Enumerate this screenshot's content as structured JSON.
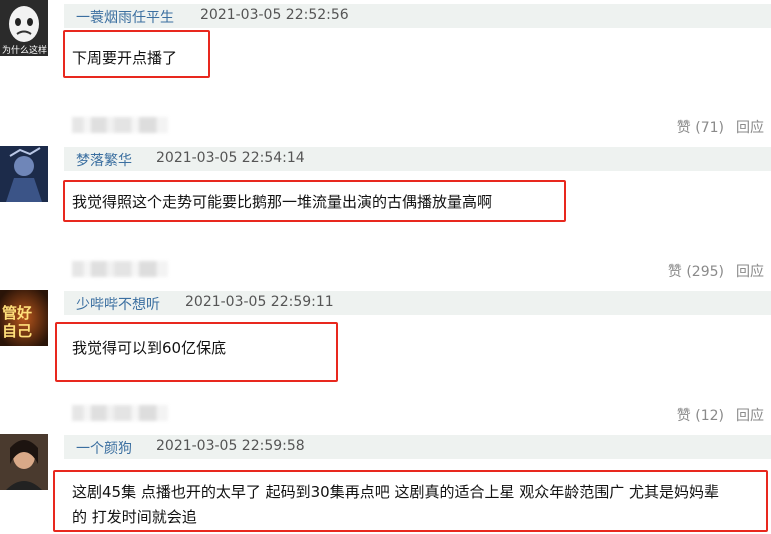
{
  "comments": [
    {
      "user": "一蓑烟雨任平生",
      "time": "2021-03-05 22:52:56",
      "text": "下周要开点播了",
      "avatar_caption": "为什么这样",
      "like_label": "赞 (71)",
      "reply_label": "回应"
    },
    {
      "user": "梦落繁华",
      "time": "2021-03-05 22:54:14",
      "text": "我觉得照这个走势可能要比鹅那一堆流量出演的古偶播放量高啊",
      "like_label": "赞 (295)",
      "reply_label": "回应"
    },
    {
      "user": "少哔哔不想听",
      "time": "2021-03-05 22:59:11",
      "text": "我觉得可以到60亿保底",
      "avatar_caption": "管好 自己",
      "like_label": "赞 (12)",
      "reply_label": "回应"
    },
    {
      "user": "一个颜狗",
      "time": "2021-03-05 22:59:58",
      "text_line1": "这剧45集 点播也开的太早了 起码到30集再点吧 这剧真的适合上星 观众年龄范围广 尤其是妈妈辈",
      "text_line2": "的 打发时间就会追"
    }
  ],
  "colors": {
    "highlight_box": "#e8281e",
    "username": "#3b6fa0",
    "meta_bar": "#eef2f0"
  }
}
